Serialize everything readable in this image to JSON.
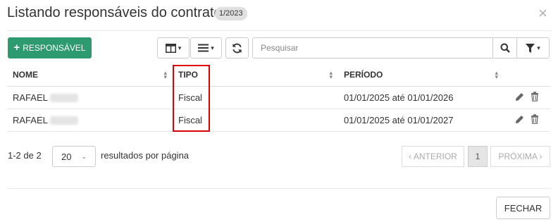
{
  "dialog": {
    "title": "Listando responsáveis do contrato",
    "badge": "1/2023",
    "close_glyph": "×"
  },
  "toolbar": {
    "add_label": "RESPONSÁVEL",
    "add_icon": "plus-icon",
    "search_placeholder": "Pesquisar",
    "accent_color": "#2e9a6f"
  },
  "table": {
    "columns": [
      "NOME",
      "TIPO",
      "PERÍODO",
      ""
    ],
    "rows": [
      {
        "nome": "RAFAEL",
        "tipo": "Fiscal",
        "periodo": "01/01/2025 até 01/01/2026"
      },
      {
        "nome": "RAFAEL",
        "tipo": "Fiscal",
        "periodo": "01/01/2025 até 01/01/2027"
      }
    ]
  },
  "pagination": {
    "count_text": "1-2 de 2",
    "per_page_value": "20",
    "per_page_label": "resultados por página",
    "prev_label": "‹ ANTERIOR",
    "current_page": "1",
    "next_label": "PRÓXIMA ›"
  },
  "footer": {
    "close_label": "FECHAR"
  }
}
